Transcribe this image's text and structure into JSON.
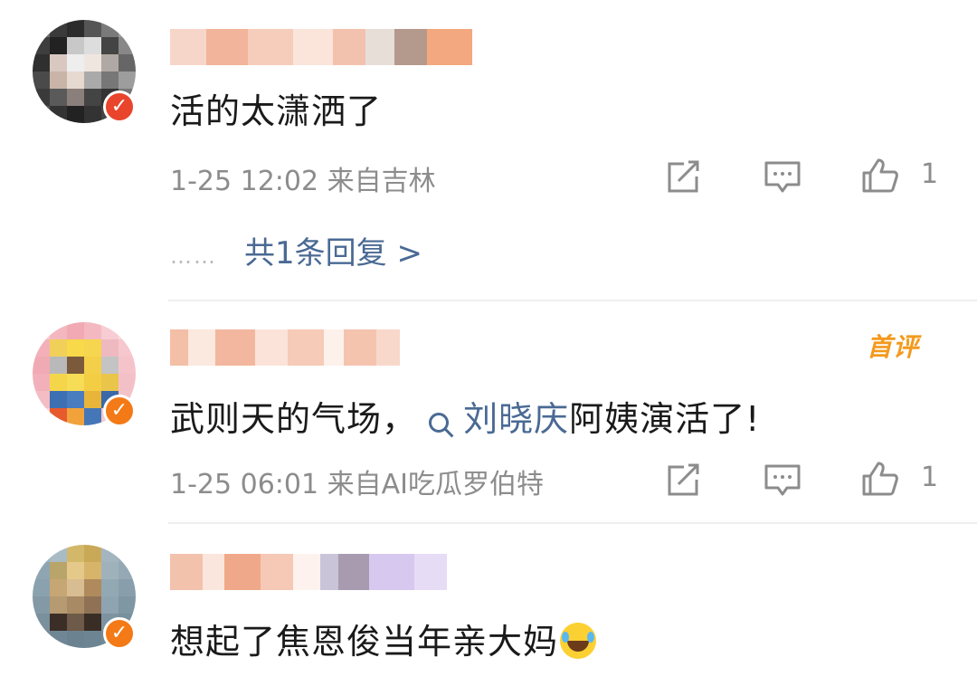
{
  "comments": [
    {
      "content": "活的太潇洒了",
      "meta": "1-25 12:02 来自吉林",
      "likes": "1",
      "reply_summary": "共1条回复 >",
      "reply_dots": "……",
      "badge_icon": "verified-v-icon",
      "badge_color": "#e8452c"
    },
    {
      "content_prefix": "武则天的气场，",
      "search_term": "刘晓庆",
      "content_suffix": "阿姨演活了!",
      "meta": "1-25 06:01 来自AI吃瓜罗伯特",
      "likes": "1",
      "first_comment_badge": "首评",
      "badge_icon": "verified-v-icon",
      "badge_color": "#f37a16"
    },
    {
      "content": "想起了焦恩俊当年亲大妈",
      "emoji": "laugh-cry-emoji",
      "badge_icon": "verified-v-icon",
      "badge_color": "#f37a16"
    }
  ],
  "colors": {
    "link": "#4a6a94",
    "meta": "#8c8c8c",
    "first_badge": "#f39a1e"
  },
  "icons": [
    "repost-icon",
    "comment-icon",
    "like-icon",
    "search-icon"
  ]
}
